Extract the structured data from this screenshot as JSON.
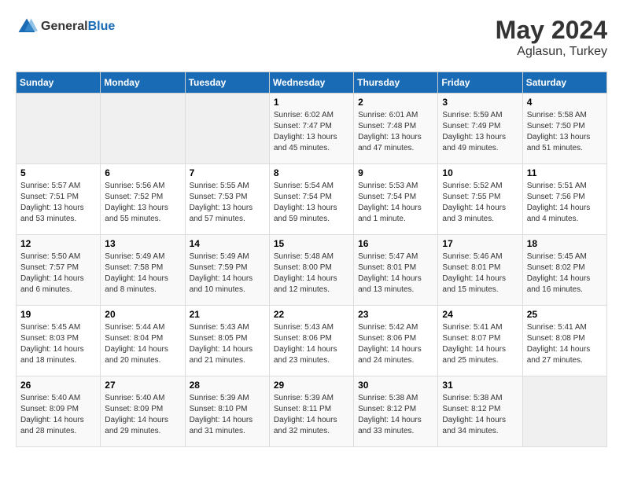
{
  "header": {
    "logo_general": "General",
    "logo_blue": "Blue",
    "title": "May 2024",
    "subtitle": "Aglasun, Turkey"
  },
  "days_of_week": [
    "Sunday",
    "Monday",
    "Tuesday",
    "Wednesday",
    "Thursday",
    "Friday",
    "Saturday"
  ],
  "weeks": [
    [
      {
        "day": "",
        "info": ""
      },
      {
        "day": "",
        "info": ""
      },
      {
        "day": "",
        "info": ""
      },
      {
        "day": "1",
        "info": "Sunrise: 6:02 AM\nSunset: 7:47 PM\nDaylight: 13 hours and 45 minutes."
      },
      {
        "day": "2",
        "info": "Sunrise: 6:01 AM\nSunset: 7:48 PM\nDaylight: 13 hours and 47 minutes."
      },
      {
        "day": "3",
        "info": "Sunrise: 5:59 AM\nSunset: 7:49 PM\nDaylight: 13 hours and 49 minutes."
      },
      {
        "day": "4",
        "info": "Sunrise: 5:58 AM\nSunset: 7:50 PM\nDaylight: 13 hours and 51 minutes."
      }
    ],
    [
      {
        "day": "5",
        "info": "Sunrise: 5:57 AM\nSunset: 7:51 PM\nDaylight: 13 hours and 53 minutes."
      },
      {
        "day": "6",
        "info": "Sunrise: 5:56 AM\nSunset: 7:52 PM\nDaylight: 13 hours and 55 minutes."
      },
      {
        "day": "7",
        "info": "Sunrise: 5:55 AM\nSunset: 7:53 PM\nDaylight: 13 hours and 57 minutes."
      },
      {
        "day": "8",
        "info": "Sunrise: 5:54 AM\nSunset: 7:54 PM\nDaylight: 13 hours and 59 minutes."
      },
      {
        "day": "9",
        "info": "Sunrise: 5:53 AM\nSunset: 7:54 PM\nDaylight: 14 hours and 1 minute."
      },
      {
        "day": "10",
        "info": "Sunrise: 5:52 AM\nSunset: 7:55 PM\nDaylight: 14 hours and 3 minutes."
      },
      {
        "day": "11",
        "info": "Sunrise: 5:51 AM\nSunset: 7:56 PM\nDaylight: 14 hours and 4 minutes."
      }
    ],
    [
      {
        "day": "12",
        "info": "Sunrise: 5:50 AM\nSunset: 7:57 PM\nDaylight: 14 hours and 6 minutes."
      },
      {
        "day": "13",
        "info": "Sunrise: 5:49 AM\nSunset: 7:58 PM\nDaylight: 14 hours and 8 minutes."
      },
      {
        "day": "14",
        "info": "Sunrise: 5:49 AM\nSunset: 7:59 PM\nDaylight: 14 hours and 10 minutes."
      },
      {
        "day": "15",
        "info": "Sunrise: 5:48 AM\nSunset: 8:00 PM\nDaylight: 14 hours and 12 minutes."
      },
      {
        "day": "16",
        "info": "Sunrise: 5:47 AM\nSunset: 8:01 PM\nDaylight: 14 hours and 13 minutes."
      },
      {
        "day": "17",
        "info": "Sunrise: 5:46 AM\nSunset: 8:01 PM\nDaylight: 14 hours and 15 minutes."
      },
      {
        "day": "18",
        "info": "Sunrise: 5:45 AM\nSunset: 8:02 PM\nDaylight: 14 hours and 16 minutes."
      }
    ],
    [
      {
        "day": "19",
        "info": "Sunrise: 5:45 AM\nSunset: 8:03 PM\nDaylight: 14 hours and 18 minutes."
      },
      {
        "day": "20",
        "info": "Sunrise: 5:44 AM\nSunset: 8:04 PM\nDaylight: 14 hours and 20 minutes."
      },
      {
        "day": "21",
        "info": "Sunrise: 5:43 AM\nSunset: 8:05 PM\nDaylight: 14 hours and 21 minutes."
      },
      {
        "day": "22",
        "info": "Sunrise: 5:43 AM\nSunset: 8:06 PM\nDaylight: 14 hours and 23 minutes."
      },
      {
        "day": "23",
        "info": "Sunrise: 5:42 AM\nSunset: 8:06 PM\nDaylight: 14 hours and 24 minutes."
      },
      {
        "day": "24",
        "info": "Sunrise: 5:41 AM\nSunset: 8:07 PM\nDaylight: 14 hours and 25 minutes."
      },
      {
        "day": "25",
        "info": "Sunrise: 5:41 AM\nSunset: 8:08 PM\nDaylight: 14 hours and 27 minutes."
      }
    ],
    [
      {
        "day": "26",
        "info": "Sunrise: 5:40 AM\nSunset: 8:09 PM\nDaylight: 14 hours and 28 minutes."
      },
      {
        "day": "27",
        "info": "Sunrise: 5:40 AM\nSunset: 8:09 PM\nDaylight: 14 hours and 29 minutes."
      },
      {
        "day": "28",
        "info": "Sunrise: 5:39 AM\nSunset: 8:10 PM\nDaylight: 14 hours and 31 minutes."
      },
      {
        "day": "29",
        "info": "Sunrise: 5:39 AM\nSunset: 8:11 PM\nDaylight: 14 hours and 32 minutes."
      },
      {
        "day": "30",
        "info": "Sunrise: 5:38 AM\nSunset: 8:12 PM\nDaylight: 14 hours and 33 minutes."
      },
      {
        "day": "31",
        "info": "Sunrise: 5:38 AM\nSunset: 8:12 PM\nDaylight: 14 hours and 34 minutes."
      },
      {
        "day": "",
        "info": ""
      }
    ]
  ]
}
